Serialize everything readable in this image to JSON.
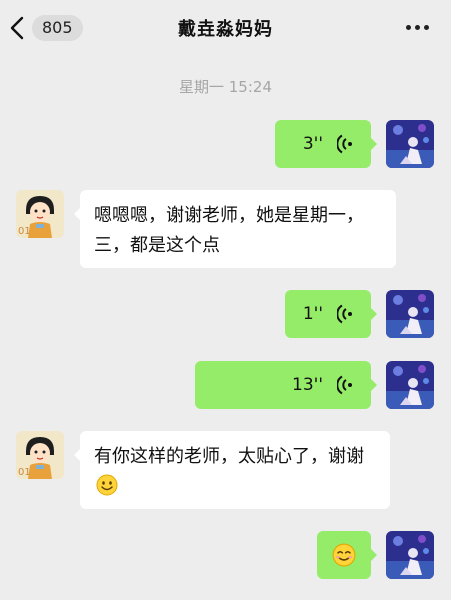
{
  "nav": {
    "unread_count": "805",
    "title": "戴垚淼妈妈"
  },
  "timestamp": "星期一 15:24",
  "messages": [
    {
      "type": "voice",
      "direction": "out",
      "duration": "3''"
    },
    {
      "type": "text",
      "direction": "in",
      "text": "嗯嗯嗯，谢谢老师，她是星期一，三，都是这个点"
    },
    {
      "type": "voice",
      "direction": "out",
      "duration": "1''"
    },
    {
      "type": "voice",
      "direction": "out",
      "duration": "13''"
    },
    {
      "type": "text",
      "direction": "in",
      "text": "有你这样的老师，太贴心了，谢谢",
      "emoji": "smile-emoji"
    },
    {
      "type": "emoji",
      "direction": "out",
      "emoji": "smile-emoji"
    }
  ],
  "colors": {
    "background": "#ededed",
    "outgoing_bubble": "#95ec69",
    "incoming_bubble": "#ffffff",
    "timestamp": "#a6a6a6"
  },
  "icons": [
    "back-chevron-icon",
    "more-dots-icon",
    "voice-wave-icon",
    "smile-emoji-icon"
  ]
}
